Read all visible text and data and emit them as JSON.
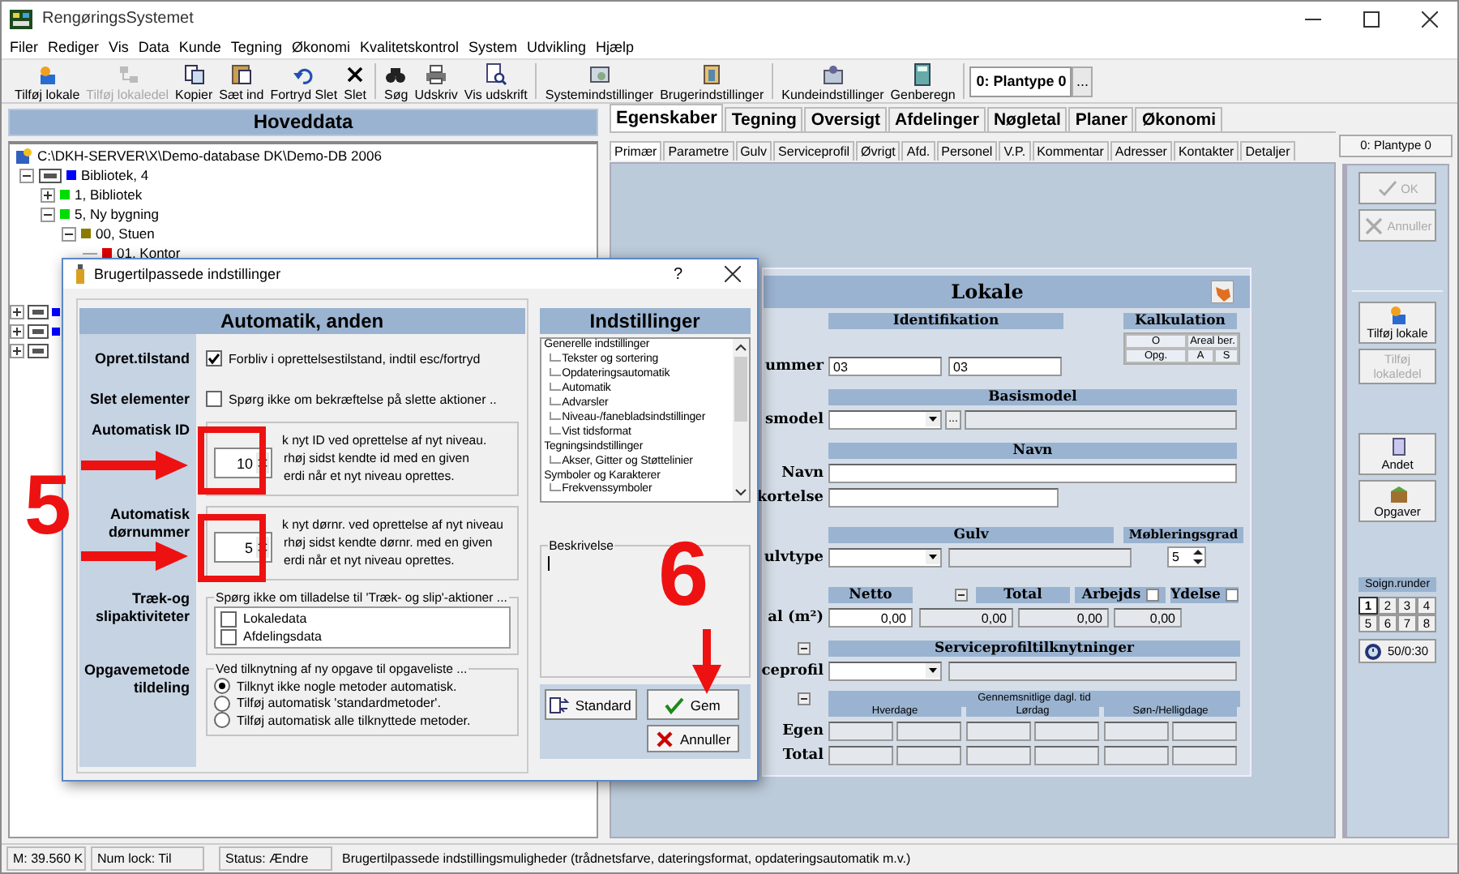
{
  "window": {
    "title": "RengøringsSystemet"
  },
  "menu": [
    {
      "label": "Filer"
    },
    {
      "label": "Rediger"
    },
    {
      "label": "Vis"
    },
    {
      "label": "Data"
    },
    {
      "label": "Kunde"
    },
    {
      "label": "Tegning"
    },
    {
      "label": "Økonomi"
    },
    {
      "label": "Kvalitetskontrol"
    },
    {
      "label": "System"
    },
    {
      "label": "Udvikling"
    },
    {
      "label": "Hjælp"
    }
  ],
  "toolbar": {
    "groups": [
      [
        {
          "label": "Tilføj lokale",
          "disabled": false
        },
        {
          "label": "Tilføj lokaledel",
          "disabled": true
        },
        {
          "label": "Kopier",
          "disabled": false
        },
        {
          "label": "Sæt ind",
          "disabled": false
        },
        {
          "label": "Fortryd Slet",
          "disabled": false
        },
        {
          "label": "Slet",
          "disabled": false
        }
      ],
      [
        {
          "label": "Søg",
          "disabled": false
        },
        {
          "label": "Udskriv",
          "disabled": false
        },
        {
          "label": "Vis udskrift",
          "disabled": false
        }
      ],
      [
        {
          "label": "Systemindstillinger",
          "disabled": false
        },
        {
          "label": "Brugerindstillinger",
          "disabled": false
        }
      ],
      [
        {
          "label": "Kundeindstillinger",
          "disabled": false
        },
        {
          "label": "Genberegn",
          "disabled": false
        }
      ]
    ],
    "plant_field": "0: Plantype 0",
    "more_button": "..."
  },
  "left_panel": {
    "title": "Hoveddata",
    "tree": {
      "label": "C:\\DKH-SERVER\\X\\Demo-database DK\\Demo-DB 2006",
      "children": [
        {
          "label": "Bibliotek, 4",
          "color": "#0000ff",
          "expanded": true,
          "children": [
            {
              "label": "1, Bibliotek",
              "color": "#00dd00",
              "expanded": false
            },
            {
              "label": "5, Ny bygning",
              "color": "#00dd00",
              "expanded": true,
              "children": [
                {
                  "label": "00, Stuen",
                  "color": "#8a7a00",
                  "expanded": true,
                  "children": [
                    {
                      "label": "01, Kontor",
                      "color": "#e00000"
                    }
                  ]
                }
              ]
            }
          ]
        }
      ]
    },
    "partial_rows": [
      {
        "expanded": false,
        "color": "#0000ff"
      },
      {
        "expanded": false,
        "color": "#0000ff"
      },
      {
        "expanded": false
      }
    ]
  },
  "main_tabs": [
    {
      "label": "Egenskaber",
      "selected": true
    },
    {
      "label": "Tegning",
      "selected": false
    },
    {
      "label": "Oversigt",
      "selected": false
    },
    {
      "label": "Afdelinger",
      "selected": false
    },
    {
      "label": "Nøgletal",
      "selected": false
    },
    {
      "label": "Planer",
      "selected": false
    },
    {
      "label": "Økonomi",
      "selected": false
    }
  ],
  "sub_tabs": [
    {
      "label": "Primær",
      "selected": true
    },
    {
      "label": "Parametre",
      "selected": false
    },
    {
      "label": "Gulv",
      "selected": false
    },
    {
      "label": "Serviceprofil",
      "selected": false
    },
    {
      "label": "Øvrigt",
      "selected": false
    },
    {
      "label": "Afd.",
      "selected": false
    },
    {
      "label": "Personel",
      "selected": false
    },
    {
      "label": "V.P.",
      "selected": false
    },
    {
      "label": "Kommentar",
      "selected": false
    },
    {
      "label": "Adresser",
      "selected": false
    },
    {
      "label": "Kontakter",
      "selected": false
    },
    {
      "label": "Detaljer",
      "selected": false
    }
  ],
  "lokale": {
    "title": "Lokale",
    "identifikation": {
      "header": "Identifikation",
      "label": "ummer",
      "values": [
        "03",
        "03"
      ]
    },
    "kalkulation": {
      "header": "Kalkulation",
      "cells": [
        "O",
        "Areal ber.",
        "Opg.",
        "A",
        "S"
      ]
    },
    "basismodel": {
      "header": "Basismodel",
      "label": "smodel",
      "button": "..."
    },
    "navn": {
      "header": "Navn",
      "labels": [
        "Navn",
        "kortelse"
      ]
    },
    "gulv": {
      "header": "Gulv",
      "label": "ulvtype"
    },
    "moebleringsgrad": {
      "header": "Møbleringsgrad",
      "value": "5"
    },
    "areal": {
      "label": "al (m²)",
      "columns": [
        {
          "header": "Netto",
          "value": "0,00"
        },
        {
          "header": "Total",
          "value": "0,00"
        },
        {
          "header": "Arbejds",
          "value": "0,00"
        },
        {
          "header": "Ydelse",
          "value": "0,00"
        }
      ]
    },
    "serviceprofil": {
      "header": "Serviceprofiltilknytninger",
      "label": "ceprofil"
    },
    "tid": {
      "header": "Gennemsnitlige dagl. tid",
      "columns": [
        "Hverdage",
        "Lørdag",
        "Søn-/Helligdage"
      ],
      "rows": [
        "Egen",
        "Total"
      ]
    }
  },
  "sidebar": {
    "plant_label": "0: Plantype 0",
    "button_groups": [
      [
        {
          "label": "OK",
          "disabled": true
        },
        {
          "label": "Annuller",
          "disabled": true
        }
      ],
      [
        {
          "label": "Tilføj lokale",
          "disabled": false
        },
        {
          "label": "Tilføj lokaledel",
          "disabled": true
        }
      ],
      [
        {
          "label": "Andet",
          "disabled": false
        },
        {
          "label": "Opgaver",
          "disabled": false
        }
      ]
    ],
    "rounds": {
      "title": "Soign.runder",
      "items": [
        {
          "label": "1",
          "selected": true
        },
        {
          "label": "2",
          "selected": false
        },
        {
          "label": "3",
          "selected": false
        },
        {
          "label": "4",
          "selected": false
        },
        {
          "label": "5",
          "selected": false
        },
        {
          "label": "6",
          "selected": false
        },
        {
          "label": "7",
          "selected": false
        },
        {
          "label": "8",
          "selected": false
        }
      ]
    },
    "time_button": "50/0:30"
  },
  "dialog": {
    "title": "Brugertilpassede indstillinger",
    "help_button": "?",
    "section_title": "Automatik, anden",
    "rows": [
      {
        "kind": "checkbox",
        "label": "Opret.tilstand",
        "text": "Forbliv i oprettelsestilstand, indtil esc/fortryd",
        "checked": true
      },
      {
        "kind": "checkbox",
        "label": "Slet elementer",
        "text": "Spørg ikke om bekræftelse på slette aktioner ..",
        "checked": false
      },
      {
        "kind": "spinner",
        "label": "Automatisk ID",
        "value": "10",
        "lines": [
          "k nyt ID ved oprettelse af nyt niveau.",
          "rhøj sidst kendte id med en given",
          "erdi når et nyt niveau oprettes."
        ]
      },
      {
        "kind": "spinner",
        "label": "Automatisk dørnummer",
        "value": "5",
        "lines": [
          "k nyt dørnr. ved oprettelse af nyt niveau",
          "rhøj sidst kendte dørnr. med en given",
          "erdi når et nyt niveau oprettes."
        ]
      },
      {
        "kind": "checklist",
        "label": "Træk-og slipaktiviteter",
        "legend": "Spørg ikke om tilladelse til 'Træk- og slip'-aktioner ...",
        "items": [
          {
            "label": "Lokaledata",
            "checked": false
          },
          {
            "label": "Afdelingsdata",
            "checked": false
          }
        ]
      },
      {
        "kind": "radios",
        "label": "Opgavemetode tildeling",
        "legend": "Ved tilknytning af ny opgave til opgaveliste ...",
        "items": [
          {
            "label": "Tilknyt ikke nogle metoder automatisk.",
            "selected": true
          },
          {
            "label": "Tilføj automatisk 'standardmetoder'.",
            "selected": false
          },
          {
            "label": "Tilføj automatisk alle tilknyttede metoder.",
            "selected": false
          }
        ]
      }
    ],
    "settings": {
      "title": "Indstillinger",
      "tree": [
        {
          "label": "Generelle indstillinger",
          "children": [
            {
              "label": "Tekster og sortering"
            },
            {
              "label": "Opdateringsautomatik"
            },
            {
              "label": "Automatik"
            },
            {
              "label": "Advarsler"
            },
            {
              "label": "Niveau-/fanebladsindstillinger"
            },
            {
              "label": "Vist tidsformat"
            }
          ]
        },
        {
          "label": "Tegningsindstillinger",
          "children": [
            {
              "label": "Akser, Gitter og Støttelinier"
            }
          ]
        },
        {
          "label": "Symboler og Karakterer",
          "children": [
            {
              "label": "Frekvenssymboler"
            }
          ]
        }
      ]
    },
    "description": {
      "legend": "Beskrivelse"
    },
    "buttons": [
      {
        "label": "Standard"
      },
      {
        "label": "Gem"
      },
      {
        "label": "Annuller"
      }
    ]
  },
  "annotations": [
    {
      "text": "5"
    },
    {
      "text": "6"
    }
  ],
  "status_bar": [
    "M: 39.560 K",
    "Num lock: Til",
    "Status: Ændre",
    "Brugertilpassede indstillingsmuligheder (trådnetsfarve, dateringsformat, opdateringsautomatik m.v.)"
  ]
}
